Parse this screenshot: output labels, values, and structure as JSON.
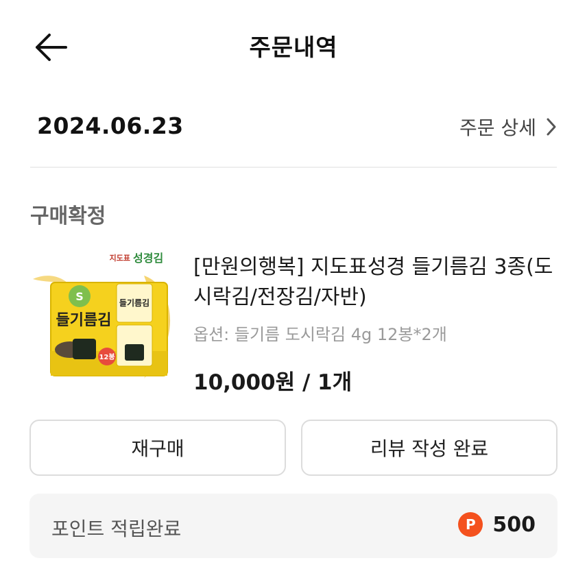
{
  "header": {
    "title": "주문내역",
    "back_icon": "arrow-left-icon"
  },
  "order": {
    "date": "2024.06.23",
    "detail_link_label": "주문 상세",
    "detail_link_icon": "chevron-right-icon",
    "status": "구매확정"
  },
  "product": {
    "name": "[만원의행복] 지도표성경 들기름김 3종(도시락김/전장김/자반)",
    "option": "옵션: 들기름 도시락김 4g 12봉*2개",
    "price": "10,000원 / 1개",
    "image": {
      "brand_small": "지도표",
      "brand_large": "성경김",
      "pack_title": "들기름김",
      "count_badge": "12봉"
    }
  },
  "actions": {
    "rebuy_label": "재구매",
    "review_label": "리뷰 작성 완료"
  },
  "points": {
    "label": "포인트 적립완료",
    "icon_letter": "P",
    "value": "500"
  },
  "colors": {
    "accent_point": "#f4511e",
    "pack_yellow": "#f5d11e"
  }
}
